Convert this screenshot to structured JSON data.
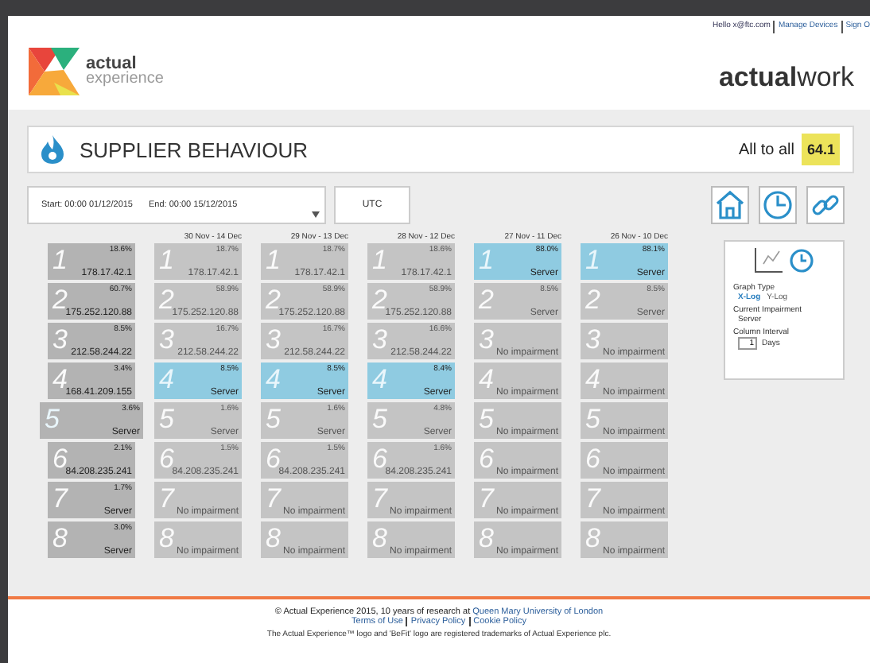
{
  "top_links": {
    "greeting": "Hello x@ftc.com",
    "links": [
      "Manage Devices",
      "Sign O"
    ]
  },
  "logo": {
    "line1": "actual",
    "line2": "experience"
  },
  "product_logo": "**actual**work",
  "title_bar": {
    "title": "SUPPLIER BEHAVIOUR",
    "scope": "All to all",
    "score": "64.1"
  },
  "date_range": {
    "start": "Start: 00:00 01/12/2015",
    "end": "End: 00:00 15/12/2015",
    "timezone": "UTC"
  },
  "columns": [
    {
      "current": true,
      "tiles": [
        {
          "rank": "1",
          "percent": "18.6%",
          "label": "178.17.42.1",
          "highlight": false
        },
        {
          "rank": "2",
          "percent": "60.7%",
          "label": "175.252.120.88",
          "highlight": false
        },
        {
          "rank": "3",
          "percent": "8.5%",
          "label": "212.58.244.22",
          "highlight": false
        },
        {
          "rank": "4",
          "percent": "3.4%",
          "label": "168.41.209.155",
          "highlight": false
        },
        {
          "rank": "5",
          "percent": "3.6%",
          "label": "Server",
          "highlight": true
        },
        {
          "rank": "6",
          "percent": "2.1%",
          "label": "84.208.235.241",
          "highlight": false
        },
        {
          "rank": "7",
          "percent": "1.7%",
          "label": "Server",
          "highlight": false
        },
        {
          "rank": "8",
          "percent": "3.0%",
          "label": "Server",
          "highlight": false
        }
      ]
    },
    {
      "header": "30 Nov - 14 Dec",
      "current": false,
      "tiles": [
        {
          "rank": "1",
          "percent": "18.7%",
          "label": "178.17.42.1",
          "highlight": false
        },
        {
          "rank": "2",
          "percent": "58.9%",
          "label": "175.252.120.88",
          "highlight": false
        },
        {
          "rank": "3",
          "percent": "16.7%",
          "label": "212.58.244.22",
          "highlight": false
        },
        {
          "rank": "4",
          "percent": "8.5%",
          "label": "Server",
          "highlight": true
        },
        {
          "rank": "5",
          "percent": "1.6%",
          "label": "Server",
          "highlight": false
        },
        {
          "rank": "6",
          "percent": "1.5%",
          "label": "84.208.235.241",
          "highlight": false
        },
        {
          "rank": "7",
          "label": "No impairment",
          "highlight": false
        },
        {
          "rank": "8",
          "label": "No impairment",
          "highlight": false
        }
      ]
    },
    {
      "header": "29 Nov - 13 Dec",
      "current": false,
      "tiles": [
        {
          "rank": "1",
          "percent": "18.7%",
          "label": "178.17.42.1",
          "highlight": false
        },
        {
          "rank": "2",
          "percent": "58.9%",
          "label": "175.252.120.88",
          "highlight": false
        },
        {
          "rank": "3",
          "percent": "16.7%",
          "label": "212.58.244.22",
          "highlight": false
        },
        {
          "rank": "4",
          "percent": "8.5%",
          "label": "Server",
          "highlight": true
        },
        {
          "rank": "5",
          "percent": "1.6%",
          "label": "Server",
          "highlight": false
        },
        {
          "rank": "6",
          "percent": "1.5%",
          "label": "84.208.235.241",
          "highlight": false
        },
        {
          "rank": "7",
          "label": "No impairment",
          "highlight": false
        },
        {
          "rank": "8",
          "label": "No impairment",
          "highlight": false
        }
      ]
    },
    {
      "header": "28 Nov - 12 Dec",
      "current": false,
      "tiles": [
        {
          "rank": "1",
          "percent": "18.6%",
          "label": "178.17.42.1",
          "highlight": false
        },
        {
          "rank": "2",
          "percent": "58.9%",
          "label": "175.252.120.88",
          "highlight": false
        },
        {
          "rank": "3",
          "percent": "16.6%",
          "label": "212.58.244.22",
          "highlight": false
        },
        {
          "rank": "4",
          "percent": "8.4%",
          "label": "Server",
          "highlight": true
        },
        {
          "rank": "5",
          "percent": "4.8%",
          "label": "Server",
          "highlight": false
        },
        {
          "rank": "6",
          "percent": "1.6%",
          "label": "84.208.235.241",
          "highlight": false
        },
        {
          "rank": "7",
          "label": "No impairment",
          "highlight": false
        },
        {
          "rank": "8",
          "label": "No impairment",
          "highlight": false
        }
      ]
    },
    {
      "header": "27 Nov - 11 Dec",
      "current": false,
      "tiles": [
        {
          "rank": "1",
          "percent": "88.0%",
          "label": "Server",
          "highlight": true
        },
        {
          "rank": "2",
          "percent": "8.5%",
          "label": "Server",
          "highlight": false
        },
        {
          "rank": "3",
          "label": "No impairment",
          "highlight": false
        },
        {
          "rank": "4",
          "label": "No impairment",
          "highlight": false
        },
        {
          "rank": "5",
          "label": "No impairment",
          "highlight": false
        },
        {
          "rank": "6",
          "label": "No impairment",
          "highlight": false
        },
        {
          "rank": "7",
          "label": "No impairment",
          "highlight": false
        },
        {
          "rank": "8",
          "label": "No impairment",
          "highlight": false
        }
      ]
    },
    {
      "header": "26 Nov - 10 Dec",
      "current": false,
      "tiles": [
        {
          "rank": "1",
          "percent": "88.1%",
          "label": "Server",
          "highlight": true
        },
        {
          "rank": "2",
          "percent": "8.5%",
          "label": "Server",
          "highlight": false
        },
        {
          "rank": "3",
          "label": "No impairment",
          "highlight": false
        },
        {
          "rank": "4",
          "label": "No impairment",
          "highlight": false
        },
        {
          "rank": "5",
          "label": "No impairment",
          "highlight": false
        },
        {
          "rank": "6",
          "label": "No impairment",
          "highlight": false
        },
        {
          "rank": "7",
          "label": "No impairment",
          "highlight": false
        },
        {
          "rank": "8",
          "label": "No impairment",
          "highlight": false
        }
      ]
    }
  ],
  "settings": {
    "graph_type_label": "Graph Type",
    "graph_types": [
      {
        "label": "X-Log",
        "selected": true
      },
      {
        "label": "Y-Log",
        "selected": false
      }
    ],
    "impairment_label": "Current Impairment",
    "impairment": "Server",
    "interval_label": "Column Interval",
    "interval": "1",
    "interval_unit": "Days"
  },
  "footer": {
    "copyright": "© Actual Experience 2015, 10 years of research at ",
    "university": "Queen Mary University of London",
    "links": [
      "Terms of Use",
      "Privacy Policy",
      "Cookie Policy"
    ],
    "fine_print": "The Actual Experience™ logo and 'BeFit' logo are registered trademarks of Actual Experience plc."
  }
}
